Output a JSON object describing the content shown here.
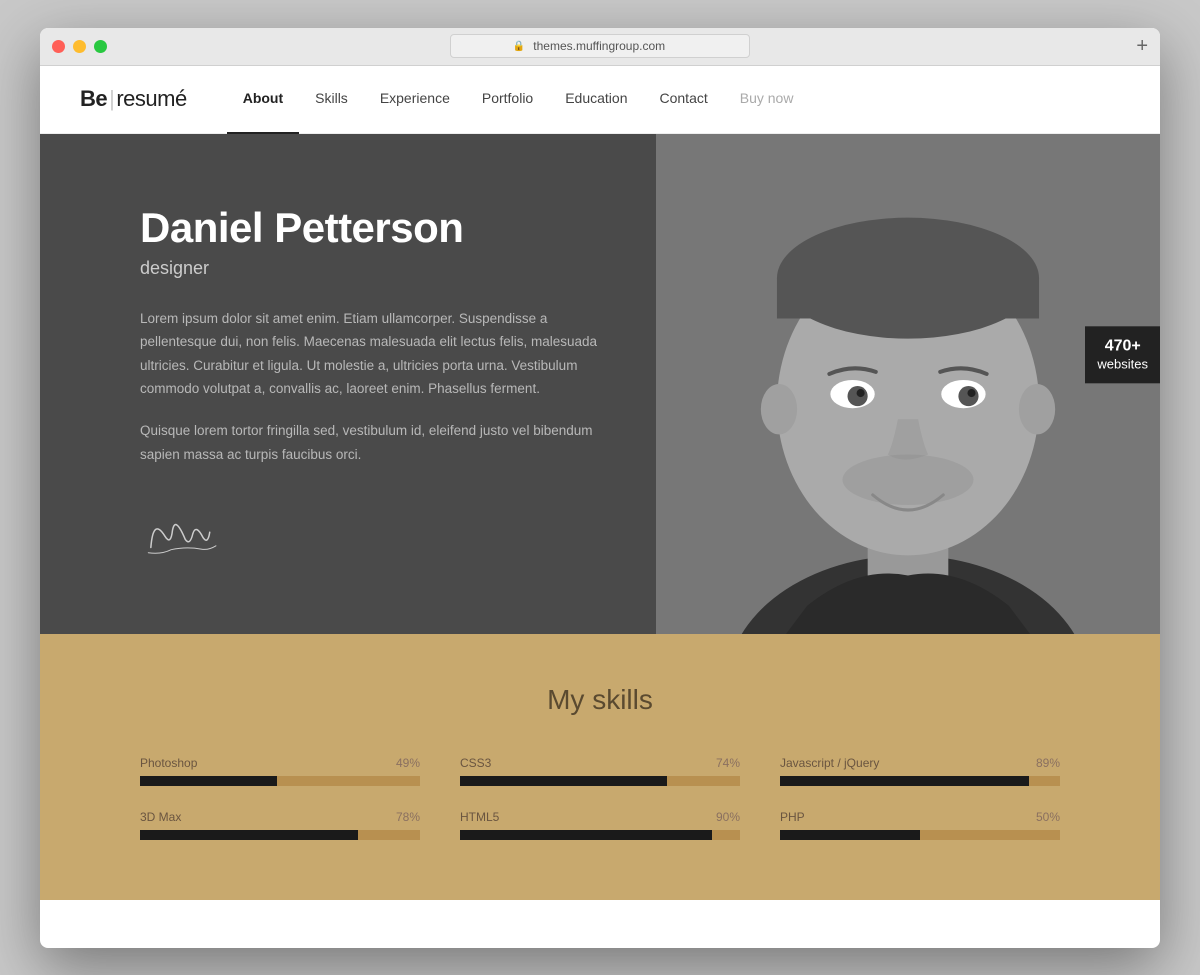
{
  "window": {
    "url": "themes.muffingroup.com",
    "buttons": {
      "close": "close",
      "minimize": "minimize",
      "maximize": "maximize"
    }
  },
  "nav": {
    "logo_bold": "Be",
    "logo_separator": "|",
    "logo_text": "resumé",
    "links": [
      {
        "label": "About",
        "active": true
      },
      {
        "label": "Skills",
        "active": false
      },
      {
        "label": "Experience",
        "active": false
      },
      {
        "label": "Portfolio",
        "active": false
      },
      {
        "label": "Education",
        "active": false
      },
      {
        "label": "Contact",
        "active": false
      },
      {
        "label": "Buy now",
        "active": false,
        "muted": true
      }
    ]
  },
  "hero": {
    "name": "Daniel Petterson",
    "title": "designer",
    "para1": "Lorem ipsum dolor sit amet enim. Etiam ullamcorper. Suspendisse a pellentesque dui, non felis. Maecenas malesuada elit lectus felis, malesuada ultricies. Curabitur et ligula. Ut molestie a, ultricies porta urna. Vestibulum commodo volutpat a, convallis ac, laoreet enim. Phasellus ferment.",
    "para2": "Quisque lorem tortor fringilla sed, vestibulum id, eleifend justo vel bibendum sapien massa ac turpis faucibus orci.",
    "signature": "~Ting"
  },
  "badge": {
    "number": "470+",
    "label": "websites"
  },
  "skills": {
    "title": "My skills",
    "items": [
      {
        "name": "Photoshop",
        "pct": 49
      },
      {
        "name": "CSS3",
        "pct": 74
      },
      {
        "name": "Javascript / jQuery",
        "pct": 89
      },
      {
        "name": "3D Max",
        "pct": 78
      },
      {
        "name": "HTML5",
        "pct": 90
      },
      {
        "name": "PHP",
        "pct": 50
      }
    ]
  }
}
